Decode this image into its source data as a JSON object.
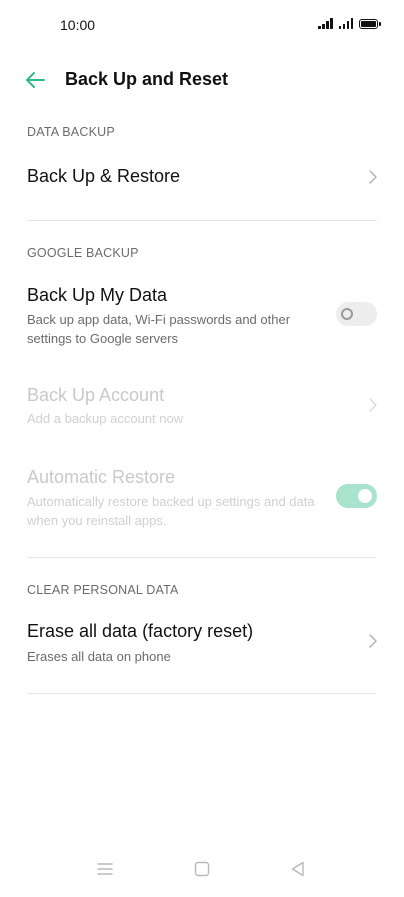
{
  "status_bar": {
    "time": "10:00"
  },
  "header": {
    "title": "Back Up and Reset"
  },
  "sections": [
    {
      "header": "DATA BACKUP",
      "items": [
        {
          "title": "Back Up & Restore"
        }
      ]
    },
    {
      "header": "GOOGLE BACKUP",
      "items": [
        {
          "title": "Back Up My Data",
          "subtitle": "Back up app data, Wi-Fi passwords and other settings to Google servers",
          "toggle": "off"
        },
        {
          "title": "Back Up Account",
          "subtitle": "Add a backup account now",
          "enabled": false
        },
        {
          "title": "Automatic Restore",
          "subtitle": "Automatically restore backed up settings and data when you reinstall apps.",
          "toggle": "on",
          "enabled": false
        }
      ]
    },
    {
      "header": "CLEAR PERSONAL DATA",
      "items": [
        {
          "title": "Erase all data (factory reset)",
          "subtitle": "Erases all data on phone"
        }
      ]
    }
  ],
  "colors": {
    "accent": "#2fb985",
    "toggle_on_disabled": "#a9e2cd"
  },
  "icons": [
    "back-arrow-icon",
    "chevron-right-icon",
    "menu-icon",
    "home-icon",
    "back-triangle-icon",
    "signal-icon",
    "battery-icon"
  ]
}
